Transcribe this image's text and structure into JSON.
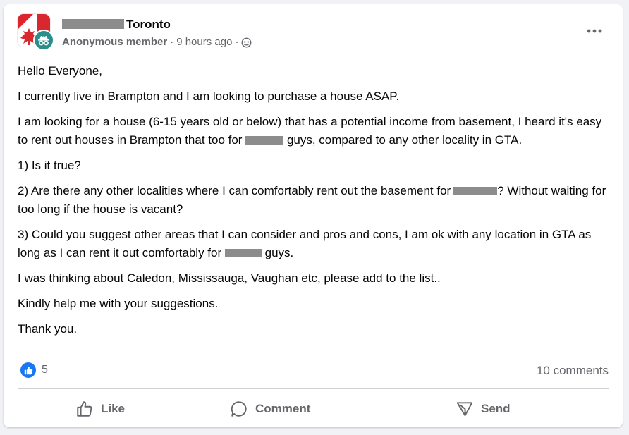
{
  "post": {
    "group_name": "Toronto",
    "author": "Anonymous member",
    "separator": "·",
    "time": "9 hours ago",
    "privacy_icon": "members-icon",
    "menu_icon": "more-options-icon",
    "paragraphs": {
      "greeting": "Hello Everyone,",
      "intro": "I currently live in Brampton and I am looking to purchase a house ASAP.",
      "p3_a": "I am looking for a house (6-15 years old or below) that has a potential income from basement, I heard it's easy to rent out houses in Brampton that too for",
      "p3_b": "guys, compared to any other locality in GTA.",
      "q1": "1) Is it true?",
      "q2_a": "2) Are there any other localities where I can comfortably rent out the basement for",
      "q2_b": "? Without waiting for too long if the house is vacant?",
      "q3_a": "3) Could you suggest other areas that I can consider and pros and cons, I am ok with any location in GTA as long as I can rent it out comfortably for",
      "q3_b": "guys.",
      "p7": "I was thinking about Caledon, Mississauga, Vaughan etc, please add to the list..",
      "p8": "Kindly help me with your suggestions.",
      "p9": "Thank you."
    }
  },
  "stats": {
    "reaction_icon": "like-icon",
    "reaction_count": "5",
    "comments": "10 comments"
  },
  "actions": {
    "like": "Like",
    "comment": "Comment",
    "send": "Send"
  },
  "colors": {
    "brand_blue": "#1877f2",
    "muted_text": "#65676b",
    "anon_badge": "#2a8f8b",
    "redaction": "#8c8c8c"
  }
}
